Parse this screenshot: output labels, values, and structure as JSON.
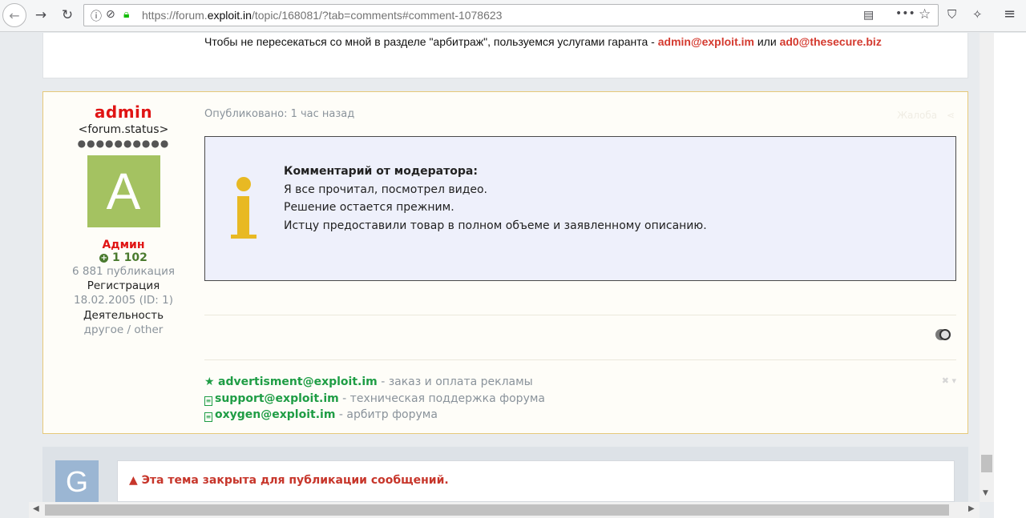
{
  "browser": {
    "url_prefix": "https://forum.",
    "url_host": "exploit.in",
    "url_path": "/topic/168081/?tab=comments#comment-1078623",
    "menu_glyph": "≡"
  },
  "prev_post": {
    "sig_text": "Чтобы не пересекаться со мной в разделе \"арбитраж\", пользуемся услугами гаранта - ",
    "email1": "admin@exploit.im",
    "or_word": " или ",
    "email2": "ad0@thesecure.biz"
  },
  "post": {
    "author": {
      "name": "admin",
      "status": "<forum.status>",
      "dots": "●●●●●●●●●●",
      "avatar_letter": "A",
      "group": "Админ",
      "reputation": "1 102",
      "posts": "6 881 публикация",
      "reg_label": "Регистрация",
      "reg_value": "18.02.2005 (ID: 1)",
      "activity_label": "Деятельность",
      "activity_value": "другое / other"
    },
    "date": "Опубликовано: 1 час назад",
    "report": "Жалоба",
    "moderator_comment": {
      "title": "Комментарий от модератора:",
      "line1": "Я все прочитал, посмотрел видео.",
      "line2": "Решение остается прежним.",
      "line3": "Истцу предоставили товар в полном объеме и заявленному описанию."
    },
    "signature": [
      {
        "email": "advertisment@exploit.im",
        "desc": " - заказ и оплата рекламы"
      },
      {
        "email": "support@exploit.im",
        "desc": " - техническая поддержка форума"
      },
      {
        "email": "oxygen@exploit.im",
        "desc": " - арбитр форума"
      }
    ]
  },
  "footer": {
    "guest_letter": "G",
    "closed_notice": "Эта тема закрыта для публикации сообщений."
  },
  "colors": {
    "admin_red": "#e01414",
    "link_green": "#1f9d45",
    "notice_red": "#c7362b"
  }
}
